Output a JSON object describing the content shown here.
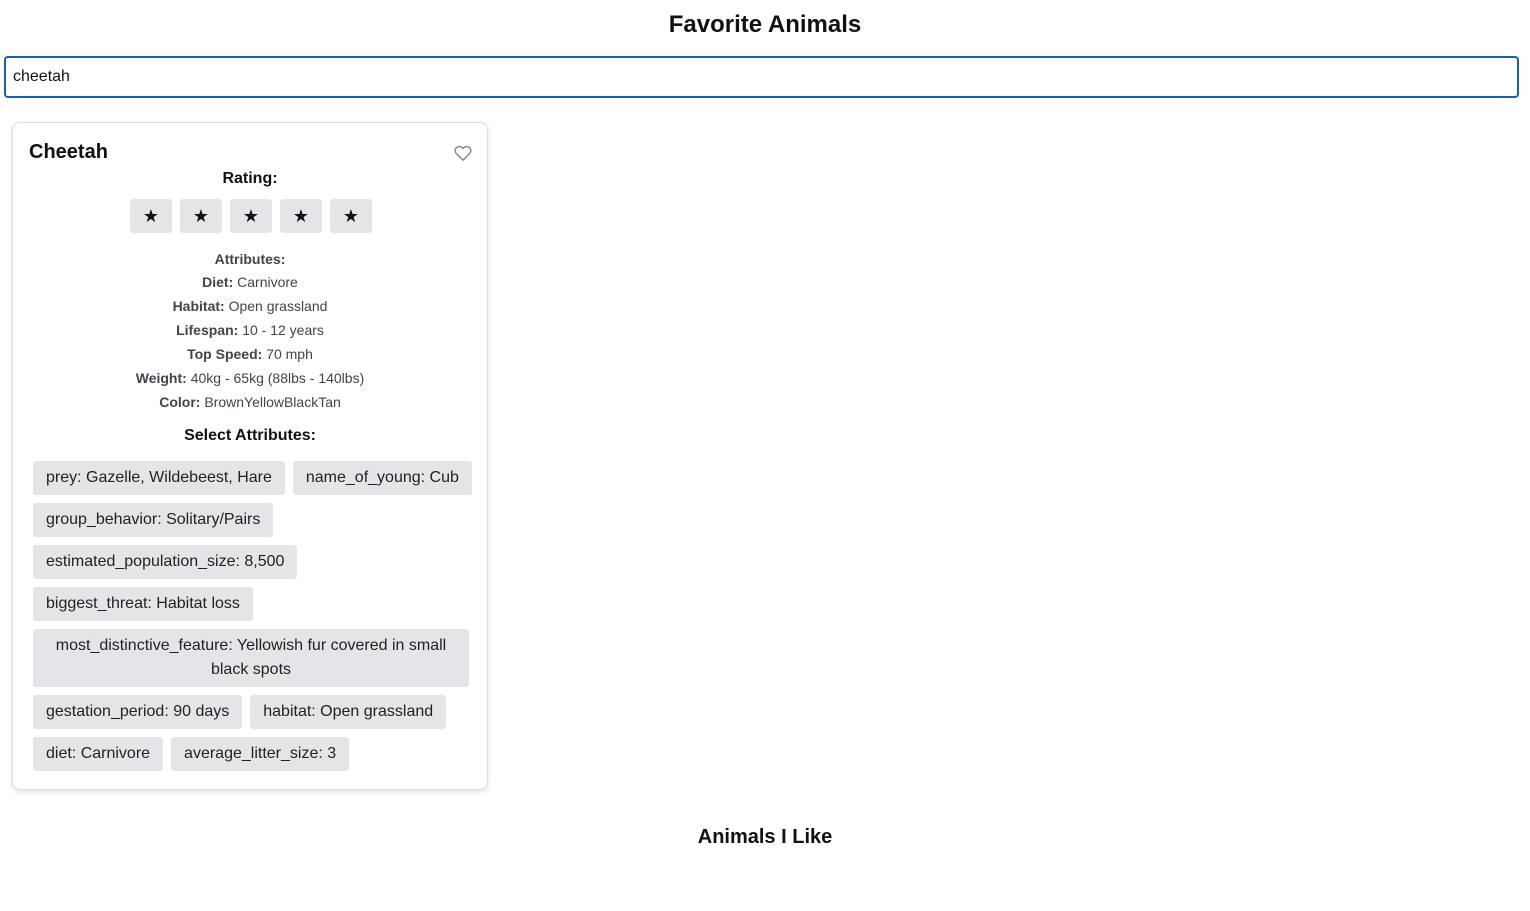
{
  "page": {
    "title": "Favorite Animals",
    "liked_title": "Animals I Like"
  },
  "search": {
    "value": "cheetah",
    "placeholder": ""
  },
  "card": {
    "name": "Cheetah",
    "favorite_icon": "heart-outline-icon",
    "rating_label": "Rating:",
    "stars": [
      "★",
      "★",
      "★",
      "★",
      "★"
    ],
    "attributes_heading": "Attributes:",
    "attributes": [
      {
        "key": "Diet:",
        "value": " Carnivore"
      },
      {
        "key": "Habitat:",
        "value": " Open grassland"
      },
      {
        "key": "Lifespan:",
        "value": " 10 - 12 years"
      },
      {
        "key": "Top Speed:",
        "value": " 70 mph"
      },
      {
        "key": "Weight:",
        "value": " 40kg - 65kg (88lbs - 140lbs)"
      },
      {
        "key": "Color:",
        "value": " BrownYellowBlackTan"
      }
    ],
    "select_label": "Select Attributes:",
    "chips": [
      "prey: Gazelle, Wildebeest, Hare",
      "name_of_young: Cub",
      "group_behavior: Solitary/Pairs",
      "estimated_population_size: 8,500",
      "biggest_threat: Habitat loss",
      "most_distinctive_feature: Yellowish fur covered in small black spots",
      "gestation_period: 90 days",
      "habitat: Open grassland",
      "diet: Carnivore",
      "average_litter_size: 3"
    ]
  },
  "colors": {
    "search_border": "#1a5fb4",
    "chip_bg": "#e4e5e9",
    "heart_stroke": "#8a8a8a"
  }
}
